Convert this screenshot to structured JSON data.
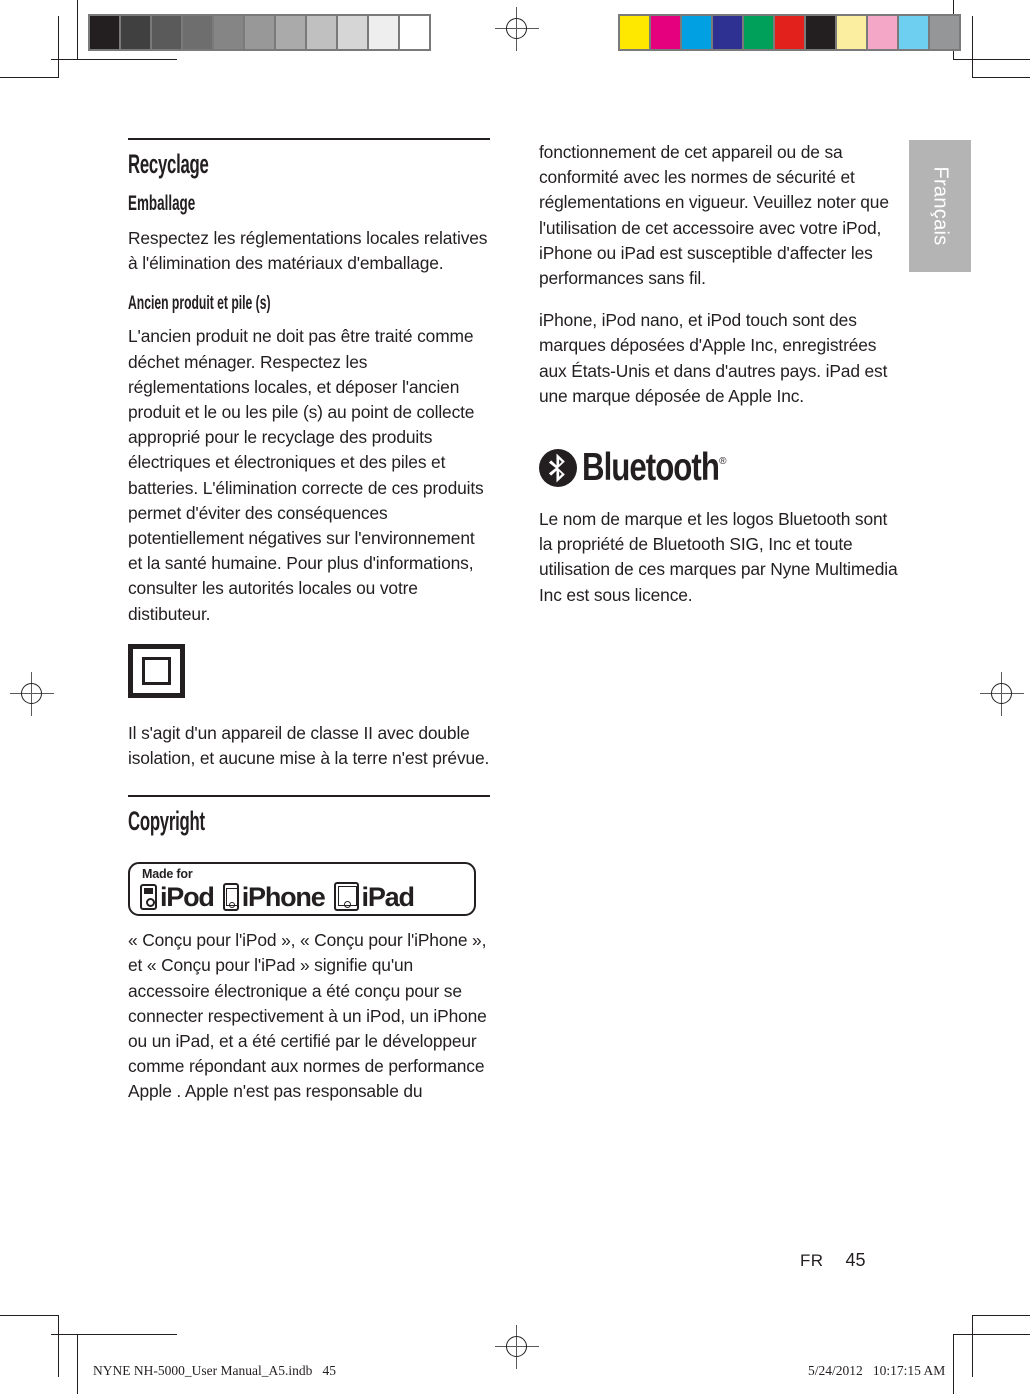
{
  "document": {
    "language_tab": "Français",
    "page_number": "45",
    "page_locale_code": "FR"
  },
  "prepress": {
    "grayscale_bar_name": "grayscale-step-wedge",
    "grayscale_swatches": [
      "#231f20",
      "#404040",
      "#5a5a5a",
      "#6e6e6e",
      "#858585",
      "#989898",
      "#aaaaaa",
      "#c0c0c0",
      "#d6d6d6",
      "#eeeeee",
      "#ffffff"
    ],
    "color_bar_name": "color-control-bar",
    "color_swatches": [
      "#ffe800",
      "#e5007e",
      "#00a0e3",
      "#2e3192",
      "#00a05a",
      "#e3211c",
      "#231f20",
      "#fbeea0",
      "#f4a7c6",
      "#6ecff0",
      "#949698"
    ],
    "registration_mark_name": "registration-target",
    "footer_file_line": "NYNE NH-5000_User Manual_A5.indb   45",
    "footer_timestamp": "5/24/2012   10:17:15 AM"
  },
  "left_column": {
    "recyclage": {
      "title": "Recyclage",
      "emballage_title": "Emballage",
      "emballage_body": "Respectez les réglementations locales relatives à l'élimination des matériaux d'emballage.",
      "ancien_title": "Ancien produit et pile (s)",
      "ancien_body": "L'ancien produit ne doit pas être traité comme déchet ménager. Respectez les réglementations locales, et déposer l'ancien produit et le ou les pile (s) au point de collecte approprié pour le recyclage des produits électriques et électroniques et des piles et batteries. L'élimination correcte de ces produits permet d'éviter des conséquences potentiellement négatives sur l'environnement et la santé humaine. Pour plus d'informations, consulter les autorités locales ou votre distibuteur.",
      "class2_icon_name": "class-ii-double-insulation-icon",
      "class2_body": "Il s'agit d'un appareil de classe II avec double isolation, et aucune mise à la terre n'est prévue."
    },
    "copyright": {
      "title": "Copyright",
      "badge": {
        "label": "Made for",
        "items": [
          {
            "device": "ipod",
            "word": "iPod"
          },
          {
            "device": "iphone",
            "word": "iPhone"
          },
          {
            "device": "ipad",
            "word": "iPad"
          }
        ]
      },
      "body": "« Conçu pour l'iPod », « Conçu pour l'iPhone », et « Conçu pour l'iPad » signifie qu'un accessoire électronique a été conçu pour se connecter respectivement à un iPod, un iPhone ou un iPad, et a été certifié par le développeur comme répondant aux normes de performance Apple . Apple n'est pas responsable du"
    }
  },
  "right_column": {
    "apple_continued": "fonctionnement de cet appareil ou de sa conformité avec les normes de sécurité et réglementations en vigueur. Veuillez noter que l'utilisation de cet accessoire avec votre iPod, iPhone ou iPad est susceptible d'affecter les performances sans fil.",
    "apple_trademarks": "iPhone, iPod nano, et iPod touch sont des marques déposées d'Apple Inc, enregistrées aux États-Unis et dans d'autres pays. iPad est une marque déposée de Apple Inc.",
    "bluetooth": {
      "wordmark": "Bluetooth",
      "registered_symbol": "®",
      "logo_icon_name": "bluetooth-rune-icon",
      "body": "Le nom de marque et les logos Bluetooth sont la propriété de Bluetooth SIG, Inc et toute utilisation de ces marques par Nyne Multimedia Inc est sous licence."
    }
  },
  "colors": {
    "ink": "#231f20",
    "tab_gray": "#b4b4b4",
    "rule": "#231f20"
  }
}
